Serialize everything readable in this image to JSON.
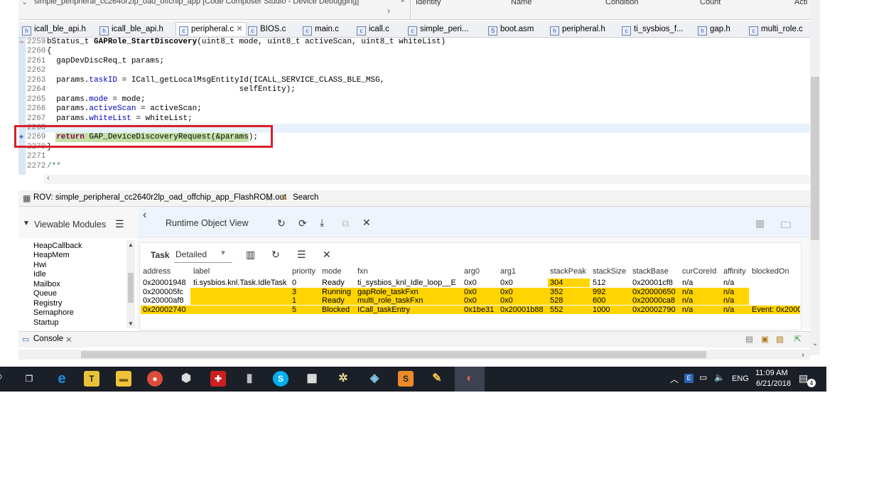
{
  "window": {
    "title": "simple_peripheral_cc2640r2lp_oad_offchip_app [Code Composer Studio - Device Debugging]",
    "breakpoint_columns": [
      "Identity",
      "Name",
      "Condition",
      "Count",
      "Acti"
    ]
  },
  "editor_tabs": [
    {
      "label": "icall_ble_api.h",
      "active": false
    },
    {
      "label": "icall_ble_api.h",
      "active": false
    },
    {
      "label": "peripheral.c",
      "active": true
    },
    {
      "label": "BIOS.c",
      "active": false
    },
    {
      "label": "main.c",
      "active": false
    },
    {
      "label": "icall.c",
      "active": false
    },
    {
      "label": "simple_peri...",
      "active": false
    },
    {
      "label": "boot.asm",
      "active": false
    },
    {
      "label": "peripheral.h",
      "active": false
    },
    {
      "label": "ti_sysbios_f...",
      "active": false
    },
    {
      "label": "gap.h",
      "active": false
    },
    {
      "label": "multi_role.c",
      "active": false
    }
  ],
  "code": {
    "l2259_num": "2259",
    "l2259_ret": "bStatus_t ",
    "l2259_fn": "GAPRole_StartDiscovery",
    "l2259_rest": "(uint8_t mode, uint8_t activeScan, uint8_t whiteList)",
    "l2260_num": "2260",
    "l2260": "{",
    "l2261_num": "2261",
    "l2261": "  gapDevDiscReq_t params;",
    "l2262_num": "2262",
    "l2263_num": "2263",
    "l2263_a": "  params.",
    "l2263_b": "taskID",
    "l2263_c": " = ICall_getLocalMsgEntityId(ICALL_SERVICE_CLASS_BLE_MSG,",
    "l2264_num": "2264",
    "l2264": "                                         selfEntity);",
    "l2265_num": "2265",
    "l2265_a": "  params.",
    "l2265_b": "mode",
    "l2265_c": " = mode;",
    "l2266_num": "2266",
    "l2266_a": "  params.",
    "l2266_b": "activeScan",
    "l2266_c": " = activeScan;",
    "l2267_num": "2267",
    "l2267_a": "  params.",
    "l2267_b": "whiteList",
    "l2267_c": " = whiteList;",
    "l2268_num": "2268",
    "l2269_num": "2269",
    "l2269_kw": "  return",
    "l2269_rest": " GAP_DeviceDiscoveryRequest(&params);",
    "l2270_num": "2270",
    "l2270": "}",
    "l2271_num": "2271",
    "l2272_num": "2272",
    "l2272": "/**"
  },
  "rov": {
    "tab_label": "ROV: simple_peripheral_cc2640r2lp_oad_offchip_app_FlashROM.out",
    "search_label": "Search",
    "viewable_modules_label": "Viewable Modules",
    "runtime_title": "Runtime Object View",
    "modules": [
      "HeapCallback",
      "HeapMem",
      "Hwi",
      "Idle",
      "Mailbox",
      "Queue",
      "Registry",
      "Semaphore",
      "Startup"
    ],
    "task_label": "Task",
    "view_mode": "Detailed",
    "columns": [
      "address",
      "label",
      "priority",
      "mode",
      "fxn",
      "arg0",
      "arg1",
      "stackPeak",
      "stackSize",
      "stackBase",
      "curCoreId",
      "affinity",
      "blockedOn"
    ],
    "rows": [
      {
        "address": "0x20001948",
        "label": "ti.sysbios.knl.Task.IdleTask",
        "priority": "0",
        "mode": "Ready",
        "fxn": "ti_sysbios_knl_Idle_loop__E",
        "arg0": "0x0",
        "arg1": "0x0",
        "stackPeak": "304",
        "stackSize": "512",
        "stackBase": "0x20001cf8",
        "curCoreId": "n/a",
        "affinity": "n/a",
        "blockedOn": ""
      },
      {
        "address": "0x200005fc",
        "label": "",
        "priority": "3",
        "mode": "Running",
        "fxn": "gapRole_taskFxn",
        "arg0": "0x0",
        "arg1": "0x0",
        "stackPeak": "352",
        "stackSize": "992",
        "stackBase": "0x20000650",
        "curCoreId": "n/a",
        "affinity": "n/a",
        "blockedOn": ""
      },
      {
        "address": "0x20000af8",
        "label": "",
        "priority": "1",
        "mode": "Ready",
        "fxn": "multi_role_taskFxn",
        "arg0": "0x0",
        "arg1": "0x0",
        "stackPeak": "528",
        "stackSize": "600",
        "stackBase": "0x20000ca8",
        "curCoreId": "n/a",
        "affinity": "n/a",
        "blockedOn": ""
      },
      {
        "address": "0x20002740",
        "label": "",
        "priority": "5",
        "mode": "Blocked",
        "fxn": "ICall_taskEntry",
        "arg0": "0x1be31",
        "arg1": "0x20001b88",
        "stackPeak": "552",
        "stackSize": "1000",
        "stackBase": "0x20002790",
        "curCoreId": "n/a",
        "affinity": "n/a",
        "blockedOn": "Event: 0x2000"
      }
    ]
  },
  "console": {
    "tab_label": "Console"
  },
  "taskbar": {
    "time": "11:09 AM",
    "date": "6/21/2018",
    "language": "ENG",
    "notifications": "4",
    "icons": [
      "task-view-icon",
      "edge-icon",
      "ti-app-icon",
      "file-explorer-icon",
      "chrome-icon",
      "box-app-icon",
      "ti-logo-icon",
      "usb-icon",
      "skype-icon",
      "calculator-icon",
      "debug-icon",
      "tool-icon",
      "sublime-icon",
      "paint-icon",
      "ccs-icon"
    ],
    "colors": {
      "background": "#1b1f27",
      "highlight": "#ffd400",
      "redbox": "#d91f2a"
    }
  }
}
